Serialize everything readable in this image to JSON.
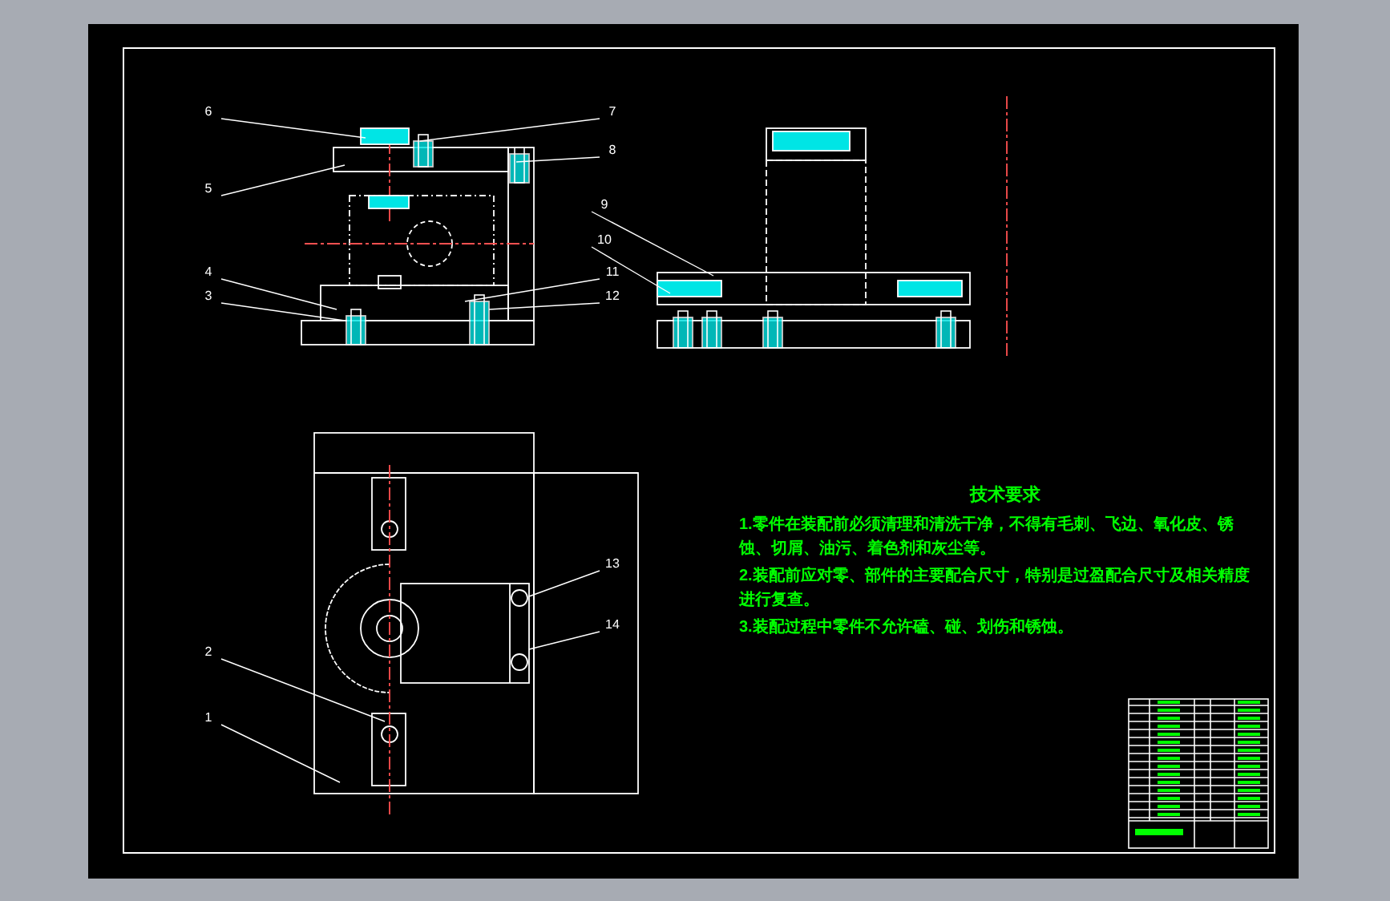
{
  "balloons": [
    {
      "label": "6"
    },
    {
      "label": "7"
    },
    {
      "label": "8"
    },
    {
      "label": "5"
    },
    {
      "label": "9"
    },
    {
      "label": "10"
    },
    {
      "label": "4"
    },
    {
      "label": "11"
    },
    {
      "label": "3"
    },
    {
      "label": "12"
    },
    {
      "label": "13"
    },
    {
      "label": "14"
    },
    {
      "label": "2"
    },
    {
      "label": "1"
    }
  ],
  "requirements": {
    "title": "技术要求",
    "items": [
      "1.零件在装配前必须清理和清洗干净，不得有毛刺、飞边、氧化皮、锈蚀、切屑、油污、着色剂和灰尘等。",
      "2.装配前应对零、部件的主要配合尺寸，特别是过盈配合尺寸及相关精度进行复查。",
      "3.装配过程中零件不允许磕、碰、划伤和锈蚀。"
    ]
  }
}
